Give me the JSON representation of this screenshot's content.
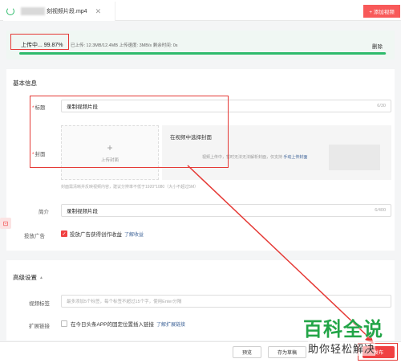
{
  "tab": {
    "file_name": "刻视频片段.mp4",
    "close_glyph": "✕"
  },
  "header": {
    "add_video_label": "+ 添加视频"
  },
  "upload": {
    "status_label": "上传中... 99.87%",
    "progress_percent": 99.87,
    "info": "已上传: 12.3MB/12.4MB  上传速度: 3MB/s  剩余时间: 0s",
    "delete_label": "删除"
  },
  "basic": {
    "section_title": "基本信息",
    "title_label": "标题",
    "title_value": "录制视频片段",
    "title_counter": "6/30",
    "cover_label": "封面",
    "cover_plus": "+",
    "cover_upload_label": "上传封面",
    "cover_pick_title": "在视频中选择封面",
    "cover_pick_hint": "视频上传中，暂时无法无法解析封面，仅支持",
    "cover_pick_link": "手动上传封面",
    "cover_note": "封面需清晰并反映视频内容，建议分辨率不低于1920*1080（大小不超过5M）",
    "summary_label": "简介",
    "summary_value": "录制视频片段",
    "summary_counter": "6/400",
    "ads_label": "投放广告",
    "ads_checkbox_label": "投放广告获得创作收益",
    "ads_link": "了解收益",
    "ads_checked": true
  },
  "advanced": {
    "section_title": "高级设置",
    "collapse_glyph": "▲",
    "tags_label": "视频标签",
    "tags_placeholder": "最多添加5个标签，每个标签不超过15个字，使用Enter分隔",
    "extend_label": "扩展链接",
    "extend_checkbox_label": "在今日头条APP的固定位置插入链接",
    "extend_link": "了解扩展链接",
    "extend_checked": false
  },
  "footer": {
    "preview_label": "预览",
    "draft_label": "存为草稿",
    "publish_label": "发布"
  },
  "side": {
    "icon_glyph": "⊡"
  },
  "watermark": {
    "main": "百科全说",
    "sub": "助你轻松解决"
  },
  "colors": {
    "brand_red": "#f04142",
    "progress_green": "#2dbb6b",
    "link_blue": "#406599",
    "annotation_red": "#e53935"
  }
}
